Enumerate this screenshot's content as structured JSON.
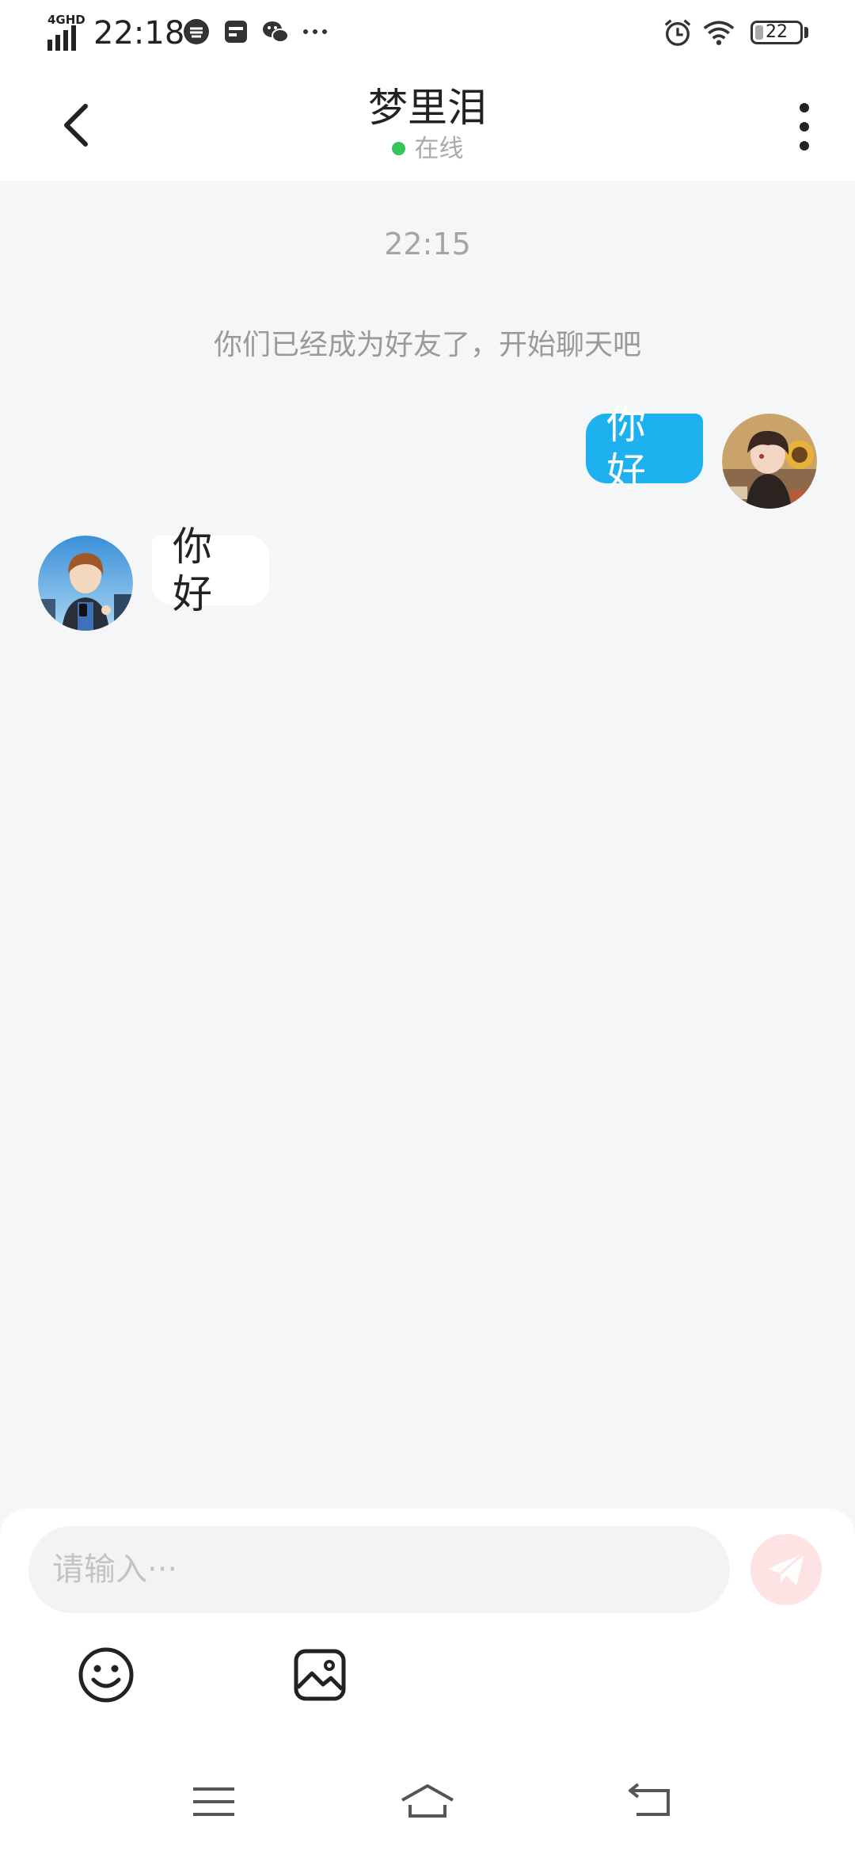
{
  "status_bar": {
    "network": "4GHD",
    "time": "22:18",
    "battery": "22"
  },
  "header": {
    "title": "梦里泪",
    "status": "在线"
  },
  "chat": {
    "timestamp": "22:15",
    "system_message": "你们已经成为好友了，开始聊天吧",
    "messages": [
      {
        "direction": "outgoing",
        "text": "你好"
      },
      {
        "direction": "incoming",
        "text": "你好"
      }
    ]
  },
  "composer": {
    "placeholder": "请输入···"
  },
  "colors": {
    "accent": "#1eb1f0",
    "online": "#36c35a",
    "send_button": "#fde3e4"
  }
}
